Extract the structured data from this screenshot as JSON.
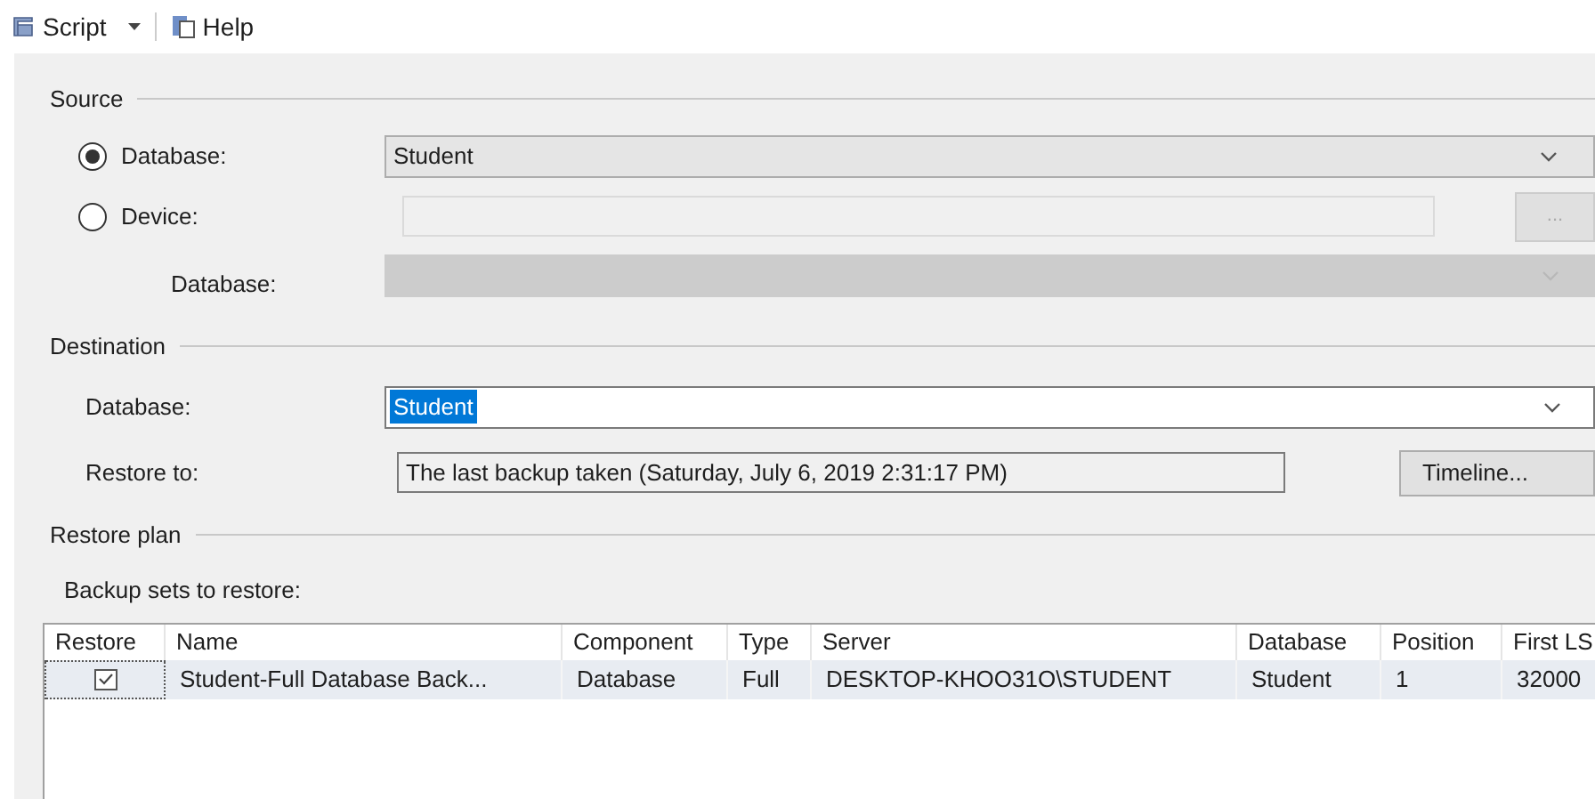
{
  "toolbar": [
    {
      "kind": "dropdown",
      "label": "Script"
    },
    {
      "kind": "button",
      "label": "Help"
    }
  ],
  "source": {
    "title": "Source",
    "options": [
      {
        "label": "Database:",
        "selected": true
      },
      {
        "label": "Device:",
        "selected": false
      }
    ],
    "database_select": {
      "value": "Student"
    },
    "browse_button": {
      "label": "...",
      "disabled": true
    },
    "database_label": "Database:",
    "database_select_disabled": true
  },
  "destination": {
    "title": "Destination",
    "database_label": "Database:",
    "database_value": "Student",
    "value_highlighted": true,
    "restore_to_label": "Restore to:",
    "restore_to_value": "The last backup taken (Saturday, July 6, 2019 2:31:17 PM)",
    "timeline_button": "Timeline..."
  },
  "restore_plan": {
    "title": "Restore plan",
    "backup_sets_label": "Backup sets to restore:",
    "table": {
      "checkbox_column": "Restore",
      "columns": [
        "Name",
        "Component",
        "Type",
        "Server",
        "Database",
        "Position",
        "First LS"
      ],
      "rows": [
        {
          "checked": true,
          "selected": true,
          "cells": [
            "Student-Full Database Back...",
            "Database",
            "Full",
            "DESKTOP-KHOO31O\\STUDENT",
            "Student",
            "1",
            "32000"
          ]
        }
      ]
    }
  }
}
